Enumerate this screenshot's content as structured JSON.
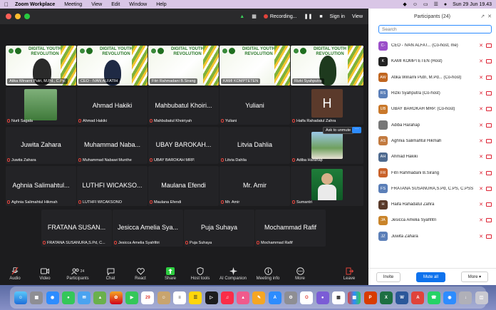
{
  "menubar": {
    "app": "Zoom Workplace",
    "items": [
      "Meeting",
      "View",
      "Edit",
      "Window",
      "Help"
    ],
    "right": {
      "recording": "Recording...",
      "datetime": "Sun 29 Jun 19.43"
    }
  },
  "zoombar": {
    "recording": "Recording...",
    "sign_in": "Sign in",
    "view": "View"
  },
  "banner_title": [
    "DIGITAL YOUTH",
    "REVOLUTION"
  ],
  "video_tiles": [
    {
      "name": "Atika Winarni Putri, M.Pd., C.Ps."
    },
    {
      "name": "CEO - IVAN ALFATIH"
    },
    {
      "name": "Fitri Rahmadani B.Sirang"
    },
    {
      "name": "KAMI KOMPTETEN"
    },
    {
      "name": "Rizki Syahputra"
    }
  ],
  "grid_tiles": [
    {
      "big": "",
      "name": "Nurli Sagala"
    },
    {
      "big": "Ahmad Hakiki",
      "name": "Ahmad Hakiki"
    },
    {
      "big": "Mahbubatul Khoiri...",
      "name": "Mahbubatul Khoiriyah"
    },
    {
      "big": "Yuliani",
      "name": "Yuliani"
    },
    {
      "big": "H",
      "name": "Haifa Rahadatul Zahra"
    },
    {
      "big": "Juwita Zahara",
      "name": "Juwita Zahara"
    },
    {
      "big": "Muhammad Naba...",
      "name": "Muhammad Nabawi Munthe"
    },
    {
      "big": "UBAY BAROKAH...",
      "name": "UBAY BAROKAH MRP."
    },
    {
      "big": "Litvia Dahlia",
      "name": "Litvia Dahlia"
    },
    {
      "big": "",
      "name": "Adiba Harahap"
    },
    {
      "big": "Aghnia Salimahtul...",
      "name": "Aghnia Salimahtul Hikmah"
    },
    {
      "big": "LUTHFI WICAKSO...",
      "name": "LUTHFI WICAKSONO"
    },
    {
      "big": "Maulana Efendi",
      "name": "Maulana Efendi"
    },
    {
      "big": "Mr. Amir",
      "name": "Mr. Amir"
    },
    {
      "big": "",
      "name": "Sumantri"
    },
    {
      "big": "FRATANA SUSAN...",
      "name": "FRATANA SUSANURA,S.Pd, C..."
    },
    {
      "big": "Jesicca Amelia Sya...",
      "name": "Jesicca Amelia Syahfitri"
    },
    {
      "big": "Puja Suhaya",
      "name": "Puja Suhaya"
    },
    {
      "big": "Mochammad Rafif",
      "name": "Mochammad Rafif"
    }
  ],
  "ask_to_unmute": "Ask to unmute",
  "toolbar": [
    {
      "label": "Audio",
      "icon": "microphone-muted-icon"
    },
    {
      "label": "Video",
      "icon": "camera-icon"
    },
    {
      "label": "Participants",
      "icon": "participants-icon",
      "badge": "24"
    },
    {
      "label": "Chat",
      "icon": "chat-icon"
    },
    {
      "label": "React",
      "icon": "heart-icon"
    },
    {
      "label": "Share",
      "icon": "share-icon"
    },
    {
      "label": "Host tools",
      "icon": "shield-icon"
    },
    {
      "label": "AI Companion",
      "icon": "sparkle-icon"
    },
    {
      "label": "Meeting info",
      "icon": "info-icon"
    },
    {
      "label": "More",
      "icon": "more-icon"
    },
    {
      "label": "Leave",
      "icon": "leave-icon"
    }
  ],
  "participants": {
    "title": "Participants (24)",
    "search_placeholder": "Search",
    "list": [
      {
        "initials": "C-",
        "color": "#9b4fc9",
        "name": "CEO - IVAN ALFAT... (Co-host, me)"
      },
      {
        "initials": "K",
        "color": "#222222",
        "name": "KAMI KOMPTETEN (Host)"
      },
      {
        "initials": "AW",
        "color": "#c0651f",
        "name": "Atika Winarni Putri, M.Pd... (Co-host)"
      },
      {
        "initials": "RS",
        "color": "#5b7fb8",
        "name": "Rizki Syahputra (Co-host)"
      },
      {
        "initials": "UB",
        "color": "#c9782a",
        "name": "UBAY BAROKAH MRP. (Co-host)"
      },
      {
        "initials": "",
        "color": "#777777",
        "name": "Adiba Harahap"
      },
      {
        "initials": "AS",
        "color": "#c27a3f",
        "name": "Aghnia Salimahtul Hikmah"
      },
      {
        "initials": "AH",
        "color": "#4e6a8f",
        "name": "Ahmad Hakiki"
      },
      {
        "initials": "FR",
        "color": "#c9622a",
        "name": "Fitri Rahmadani B.Sirang"
      },
      {
        "initials": "FS",
        "color": "#5b7fb8",
        "name": "FRATANA SUSANURA,S.Pd, C.PS, C.PSS"
      },
      {
        "initials": "H",
        "color": "#5a3a2a",
        "name": "Haifa Rahadatul Zahra"
      },
      {
        "initials": "JA",
        "color": "#c9842a",
        "name": "Jesicca Amelia Syahfitri"
      },
      {
        "initials": "JZ",
        "color": "#5b7fb8",
        "name": "Juwita Zahara"
      }
    ],
    "footer": {
      "invite": "Invite",
      "mute_all": "Mute all",
      "more": "More"
    }
  },
  "dock_calendar_day": "29"
}
